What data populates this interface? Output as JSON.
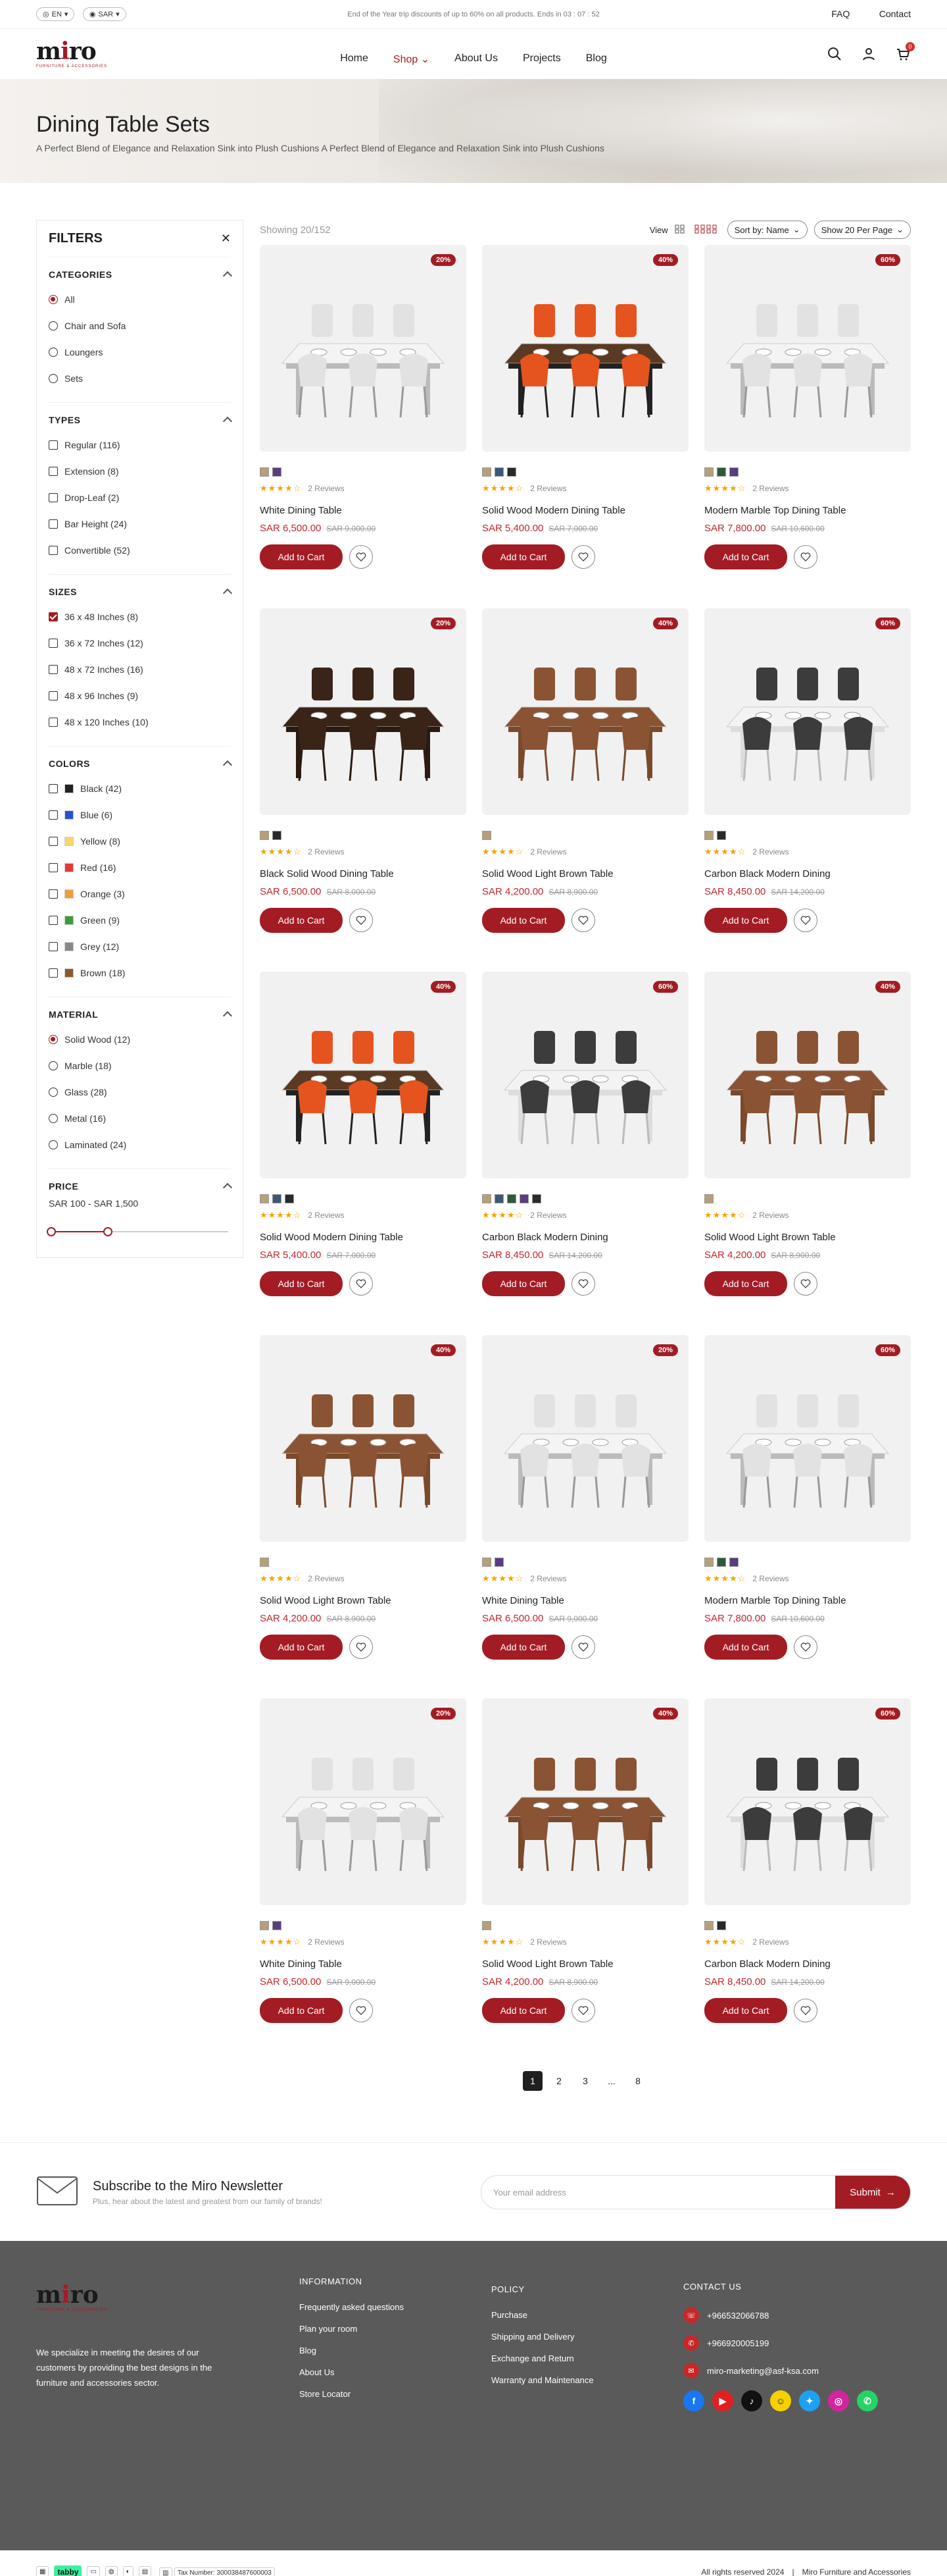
{
  "topbar": {
    "lang": "EN",
    "currency": "SAR",
    "promo": "End of the Year trip discounts of up to 60% on all products. Ends in 03 : 07 : 52",
    "faq": "FAQ",
    "contact": "Contact"
  },
  "brand": {
    "name_a": "m",
    "name_i": "i",
    "name_b": "ro",
    "tagline": "FURNITURE & ACCESSORIES"
  },
  "nav": {
    "home": "Home",
    "shop": "Shop",
    "about": "About Us",
    "projects": "Projects",
    "blog": "Blog"
  },
  "cart_count": "0",
  "hero": {
    "title": "Dining Table Sets",
    "subtitle": "A Perfect Blend of Elegance and Relaxation Sink into Plush Cushions A Perfect Blend of Elegance and Relaxation Sink into Plush Cushions"
  },
  "filters": {
    "title": "FILTERS",
    "categories": {
      "title": "CATEGORIES",
      "items": [
        "All",
        "Chair and Sofa",
        "Loungers",
        "Sets"
      ]
    },
    "types": {
      "title": "TYPES",
      "items": [
        "Regular (116)",
        "Extension (8)",
        "Drop-Leaf (2)",
        "Bar Height (24)",
        "Convertible (52)"
      ]
    },
    "sizes": {
      "title": "SIZES",
      "items": [
        "36 x 48 Inches (8)",
        "36 x 72 Inches (12)",
        "48 x 72 Inches (16)",
        "48 x 96 Inches (9)",
        "48 x 120 Inches (10)"
      ]
    },
    "colors": {
      "title": "COLORS",
      "items": [
        {
          "label": "Black (42)",
          "hex": "#222222"
        },
        {
          "label": "Blue (6)",
          "hex": "#2a4fd6"
        },
        {
          "label": "Yellow (8)",
          "hex": "#f5d76e"
        },
        {
          "label": "Red (16)",
          "hex": "#e53935"
        },
        {
          "label": "Orange (3)",
          "hex": "#f39c3c"
        },
        {
          "label": "Green (9)",
          "hex": "#3a9d3a"
        },
        {
          "label": "Grey (12)",
          "hex": "#888888"
        },
        {
          "label": "Brown (18)",
          "hex": "#8b5a2b"
        }
      ]
    },
    "material": {
      "title": "MATERIAL",
      "items": [
        "Solid Wood (12)",
        "Marble (18)",
        "Glass (28)",
        "Metal (16)",
        "Laminated (24)"
      ]
    },
    "price": {
      "title": "PRICE",
      "range": "SAR 100 - SAR 1,500",
      "low_fraction": 0.0,
      "high_fraction": 0.32
    }
  },
  "toolbar": {
    "showing": "Showing 20/152",
    "view": "View",
    "sort": "Sort by: Name",
    "per_page": "Show 20 Per Page"
  },
  "product_labels": {
    "add": "Add to Cart",
    "reviews": "2 Reviews",
    "stars": "★★★★☆"
  },
  "products": [
    {
      "name": "White Dining Table",
      "price": "SAR 6,500.00",
      "old": "SAR 9,000.00",
      "disc": "20%",
      "img": "white",
      "sw": [
        "#b5a07a",
        "#5a3d80"
      ]
    },
    {
      "name": "Solid Wood Modern Dining Table",
      "price": "SAR 5,400.00",
      "old": "SAR 7,000.00",
      "disc": "40%",
      "img": "orange",
      "sw": [
        "#b5a07a",
        "#3b5878",
        "#2a2a2a"
      ]
    },
    {
      "name": "Modern Marble Top Dining Table",
      "price": "SAR 7,800.00",
      "old": "SAR 10,600.00",
      "disc": "60%",
      "img": "white",
      "sw": [
        "#b5a07a",
        "#2e5a3a",
        "#5a3d80"
      ]
    },
    {
      "name": "Black Solid Wood Dining Table",
      "price": "SAR 6,500.00",
      "old": "SAR 8,000.00",
      "disc": "20%",
      "img": "black",
      "sw": [
        "#b5a07a",
        "#2a2a2a"
      ]
    },
    {
      "name": "Solid Wood Light Brown Table",
      "price": "SAR 4,200.00",
      "old": "SAR 8,900.00",
      "disc": "40%",
      "img": "brown",
      "sw": [
        "#b5a07a"
      ]
    },
    {
      "name": "Carbon Black Modern Dining",
      "price": "SAR 8,450.00",
      "old": "SAR 14,200.00",
      "disc": "60%",
      "img": "carbon",
      "sw": [
        "#b5a07a",
        "#2a2a2a"
      ]
    },
    {
      "name": "Solid Wood Modern Dining Table",
      "price": "SAR 5,400.00",
      "old": "SAR 7,000.00",
      "disc": "40%",
      "img": "orange",
      "sw": [
        "#b5a07a",
        "#3b5878",
        "#2a2a2a"
      ]
    },
    {
      "name": "Carbon Black Modern Dining",
      "price": "SAR 8,450.00",
      "old": "SAR 14,200.00",
      "disc": "60%",
      "img": "carbon",
      "sw": [
        "#b5a07a",
        "#3b5878",
        "#2e5a3a",
        "#5a3d80",
        "#2a2a2a"
      ]
    },
    {
      "name": "Solid Wood Light Brown Table",
      "price": "SAR 4,200.00",
      "old": "SAR 8,900.00",
      "disc": "40%",
      "img": "brown",
      "sw": [
        "#b5a07a"
      ]
    },
    {
      "name": "Solid Wood Light Brown Table",
      "price": "SAR 4,200.00",
      "old": "SAR 8,900.00",
      "disc": "40%",
      "img": "brown",
      "sw": [
        "#b5a07a"
      ]
    },
    {
      "name": "White Dining Table",
      "price": "SAR 6,500.00",
      "old": "SAR 9,000.00",
      "disc": "20%",
      "img": "white",
      "sw": [
        "#b5a07a",
        "#5a3d80"
      ]
    },
    {
      "name": "Modern Marble Top Dining Table",
      "price": "SAR 7,800.00",
      "old": "SAR 10,600.00",
      "disc": "60%",
      "img": "white",
      "sw": [
        "#b5a07a",
        "#2e5a3a",
        "#5a3d80"
      ]
    },
    {
      "name": "White Dining Table",
      "price": "SAR 6,500.00",
      "old": "SAR 9,000.00",
      "disc": "20%",
      "img": "white",
      "sw": [
        "#b5a07a",
        "#5a3d80"
      ]
    },
    {
      "name": "Solid Wood Light Brown Table",
      "price": "SAR 4,200.00",
      "old": "SAR 8,900.00",
      "disc": "40%",
      "img": "brown",
      "sw": [
        "#b5a07a"
      ]
    },
    {
      "name": "Carbon Black Modern Dining",
      "price": "SAR 8,450.00",
      "old": "SAR 14,200.00",
      "disc": "60%",
      "img": "carbon",
      "sw": [
        "#b5a07a",
        "#2a2a2a"
      ]
    }
  ],
  "pager": {
    "p1": "1",
    "p2": "2",
    "p3": "3",
    "dots": "...",
    "last": "8"
  },
  "newsletter": {
    "title": "Subscribe to the Miro Newsletter",
    "sub": "Plus, hear about the latest and greatest from our family of brands!",
    "placeholder": "Your email address",
    "submit": "Submit"
  },
  "footer": {
    "about": "We specialize in meeting the desires of our customers by providing the best designs in the furniture and accessories sector.",
    "info_title": "INFORMATION",
    "info": [
      "Frequently asked questions",
      "Plan your room",
      "Blog",
      "About Us",
      "Store Locator"
    ],
    "policy_title": "POLICY",
    "policy": [
      "Purchase",
      "Shipping and Delivery",
      "Exchange and Return",
      "Warranty and Maintenance"
    ],
    "contact_title": "CONTACT US",
    "phone1": "+966532066788",
    "phone2": "+966920005199",
    "email": "miro-marketing@asf-ksa.com"
  },
  "bottom": {
    "tabby": "tabby",
    "tax": "Tax Number: 300038487600003",
    "rights": "All rights reserved 2024",
    "sep": "|",
    "company": "Miro Furniture and Accessories"
  }
}
